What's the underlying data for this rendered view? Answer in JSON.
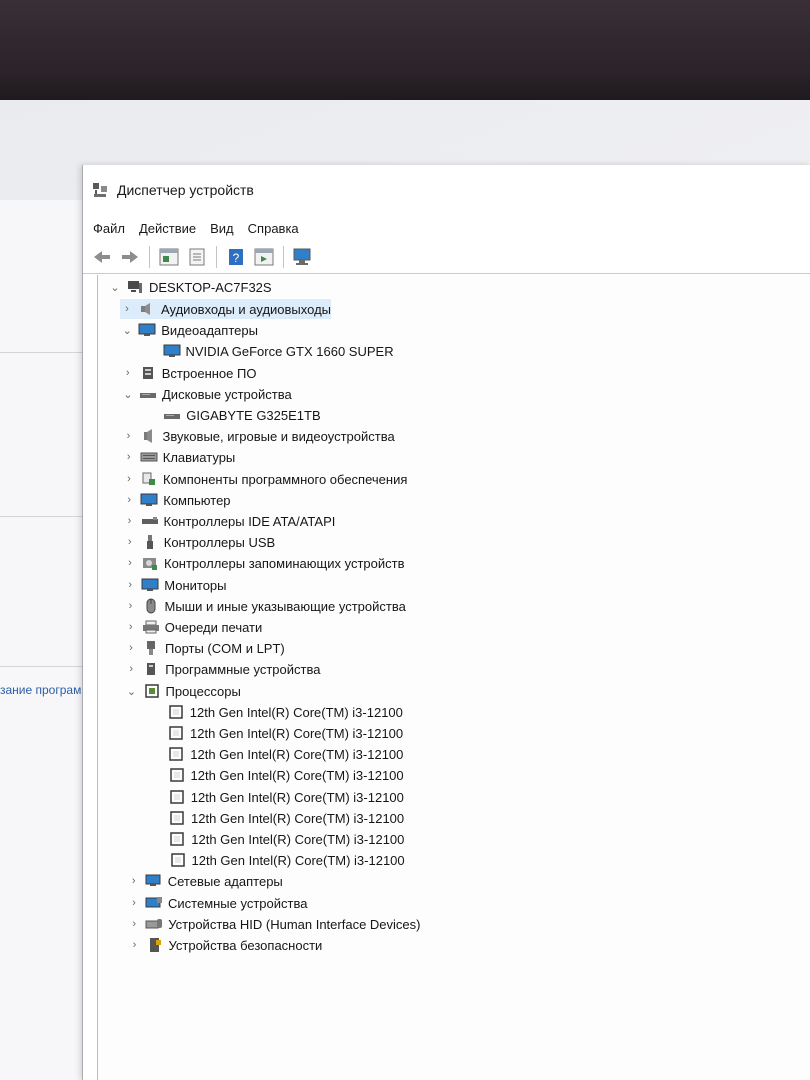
{
  "window": {
    "title": "Диспетчер устройств",
    "menu": [
      "Файл",
      "Действие",
      "Вид",
      "Справка"
    ]
  },
  "background_link": "зание програм",
  "tree": {
    "root": "DESKTOP-AC7F32S",
    "items": [
      {
        "label": "Аудиовходы и аудиовыходы",
        "icon": "speaker-icon",
        "expanded": false
      },
      {
        "label": "Видеоадаптеры",
        "icon": "display-adapter-icon",
        "expanded": true,
        "children": [
          "NVIDIA GeForce GTX 1660 SUPER"
        ]
      },
      {
        "label": "Встроенное ПО",
        "icon": "firmware-icon",
        "expanded": false
      },
      {
        "label": "Дисковые устройства",
        "icon": "disk-icon",
        "expanded": true,
        "children": [
          "GIGABYTE G325E1TB"
        ]
      },
      {
        "label": "Звуковые, игровые и видеоустройства",
        "icon": "sound-icon",
        "expanded": false
      },
      {
        "label": "Клавиатуры",
        "icon": "keyboard-icon",
        "expanded": false
      },
      {
        "label": "Компоненты программного обеспечения",
        "icon": "software-component-icon",
        "expanded": false
      },
      {
        "label": "Компьютер",
        "icon": "computer-icon",
        "expanded": false
      },
      {
        "label": "Контроллеры IDE ATA/ATAPI",
        "icon": "ide-controller-icon",
        "expanded": false
      },
      {
        "label": "Контроллеры USB",
        "icon": "usb-icon",
        "expanded": false
      },
      {
        "label": "Контроллеры запоминающих устройств",
        "icon": "storage-controller-icon",
        "expanded": false
      },
      {
        "label": "Мониторы",
        "icon": "monitor-icon",
        "expanded": false
      },
      {
        "label": "Мыши и иные указывающие устройства",
        "icon": "mouse-icon",
        "expanded": false
      },
      {
        "label": "Очереди печати",
        "icon": "printer-icon",
        "expanded": false
      },
      {
        "label": "Порты (COM и LPT)",
        "icon": "port-icon",
        "expanded": false
      },
      {
        "label": "Программные устройства",
        "icon": "software-device-icon",
        "expanded": false
      },
      {
        "label": "Процессоры",
        "icon": "processor-icon",
        "expanded": true,
        "children": [
          "12th Gen Intel(R) Core(TM) i3-12100",
          "12th Gen Intel(R) Core(TM) i3-12100",
          "12th Gen Intel(R) Core(TM) i3-12100",
          "12th Gen Intel(R) Core(TM) i3-12100",
          "12th Gen Intel(R) Core(TM) i3-12100",
          "12th Gen Intel(R) Core(TM) i3-12100",
          "12th Gen Intel(R) Core(TM) i3-12100",
          "12th Gen Intel(R) Core(TM) i3-12100"
        ]
      },
      {
        "label": "Сетевые адаптеры",
        "icon": "network-adapter-icon",
        "expanded": false
      },
      {
        "label": "Системные устройства",
        "icon": "system-devices-icon",
        "expanded": false
      },
      {
        "label": "Устройства HID (Human Interface Devices)",
        "icon": "hid-icon",
        "expanded": false
      },
      {
        "label": "Устройства безопасности",
        "icon": "security-device-icon",
        "expanded": false
      }
    ]
  },
  "colors": {
    "selection": "#dcecfb",
    "folder_blue": "#2f7fc9",
    "toolbar_green": "#3d8a4a"
  }
}
